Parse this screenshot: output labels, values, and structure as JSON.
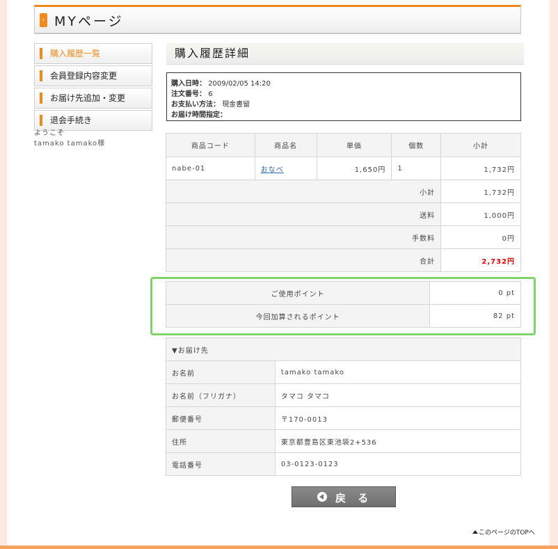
{
  "header": {
    "title": "MYページ",
    "icon": "chevron-right-icon",
    "accent": "#f08a1d"
  },
  "sidebar": {
    "items": [
      {
        "label": "購入履歴一覧",
        "active": true
      },
      {
        "label": "会員登録内容変更"
      },
      {
        "label": "お届け先追加・変更"
      },
      {
        "label": "退会手続き"
      }
    ],
    "welcome_line1": "ようこそ",
    "welcome_line2": "tamako tamako様"
  },
  "main": {
    "title": "購入履歴詳細",
    "order": {
      "date_label": "購入日時：",
      "date_value": "2009/02/05 14:20",
      "number_label": "注文番号：",
      "number_value": "6",
      "payment_label": "お支払い方法：",
      "payment_value": "現金書留",
      "time_label": "お届け時間指定："
    },
    "items_table": {
      "headers": [
        "商品コード",
        "商品名",
        "単価",
        "個数",
        "小計"
      ],
      "rows": [
        {
          "code": "nabe-01",
          "name": "おなべ",
          "price": "1,650円",
          "qty": "1",
          "subtotal": "1,732円"
        }
      ],
      "summary": [
        {
          "label": "小計",
          "value": "1,732円"
        },
        {
          "label": "送料",
          "value": "1,000円"
        },
        {
          "label": "手数料",
          "value": "0円"
        },
        {
          "label": "合計",
          "value": "2,732円"
        }
      ]
    },
    "points": [
      {
        "label": "ご使用ポイント",
        "value": "0 pt"
      },
      {
        "label": "今回加算されるポイント",
        "value": "82 pt"
      }
    ],
    "shipping": {
      "title": "▼お届け先",
      "rows": [
        {
          "label": "お名前",
          "value": "tamako tamako"
        },
        {
          "label": "お名前（フリガナ）",
          "value": "タマコ タマコ"
        },
        {
          "label": "郵便番号",
          "value": "〒170-0013"
        },
        {
          "label": "住所",
          "value": "東京都豊島区東池袋2+536"
        },
        {
          "label": "電話番号",
          "value": "03-0123-0123"
        }
      ]
    },
    "back_label": "戻 る",
    "to_top_label": "このページのTOPへ"
  },
  "colors": {
    "highlight": "#7ed36a",
    "total_red": "#e00000",
    "link": "#2a62a8"
  }
}
